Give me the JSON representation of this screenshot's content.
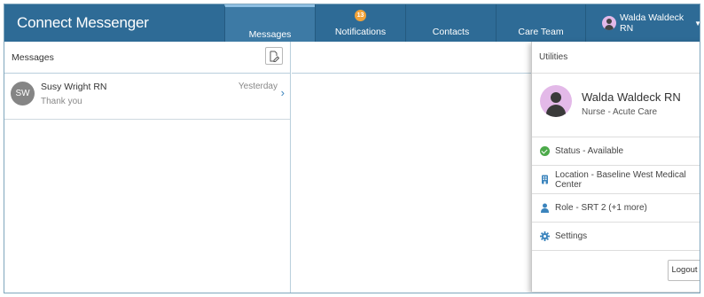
{
  "app": {
    "title": "Connect Messenger"
  },
  "nav": {
    "tabs": [
      {
        "label": "Messages",
        "active": true
      },
      {
        "label": "Notifications",
        "badge": "13"
      },
      {
        "label": "Contacts"
      },
      {
        "label": "Care Team"
      }
    ]
  },
  "user_menu": {
    "name": "Walda Waldeck RN",
    "icon": "chevron-down-icon"
  },
  "messages_pane": {
    "title": "Messages",
    "compose_icon": "compose-icon",
    "conversations": [
      {
        "initials": "SW",
        "name": "Susy Wright RN",
        "preview": "Thank you",
        "time": "Yesterday"
      }
    ]
  },
  "utilities": {
    "title": "Utilities",
    "profile": {
      "name": "Walda Waldeck RN",
      "role": "Nurse - Acute Care"
    },
    "items": [
      {
        "label": "Status - Available",
        "icon": "status-check-icon"
      },
      {
        "label": "Location - Baseline West Medical Center",
        "icon": "building-icon"
      },
      {
        "label": "Role - SRT 2 (+1 more)",
        "icon": "person-icon"
      },
      {
        "label": "Settings",
        "icon": "gear-icon"
      }
    ],
    "logout_label": "Logout"
  },
  "colors": {
    "header_bg": "#2e6b96",
    "accent": "#3b84bd",
    "badge": "#f0a33a",
    "status_available": "#4caa4a"
  }
}
